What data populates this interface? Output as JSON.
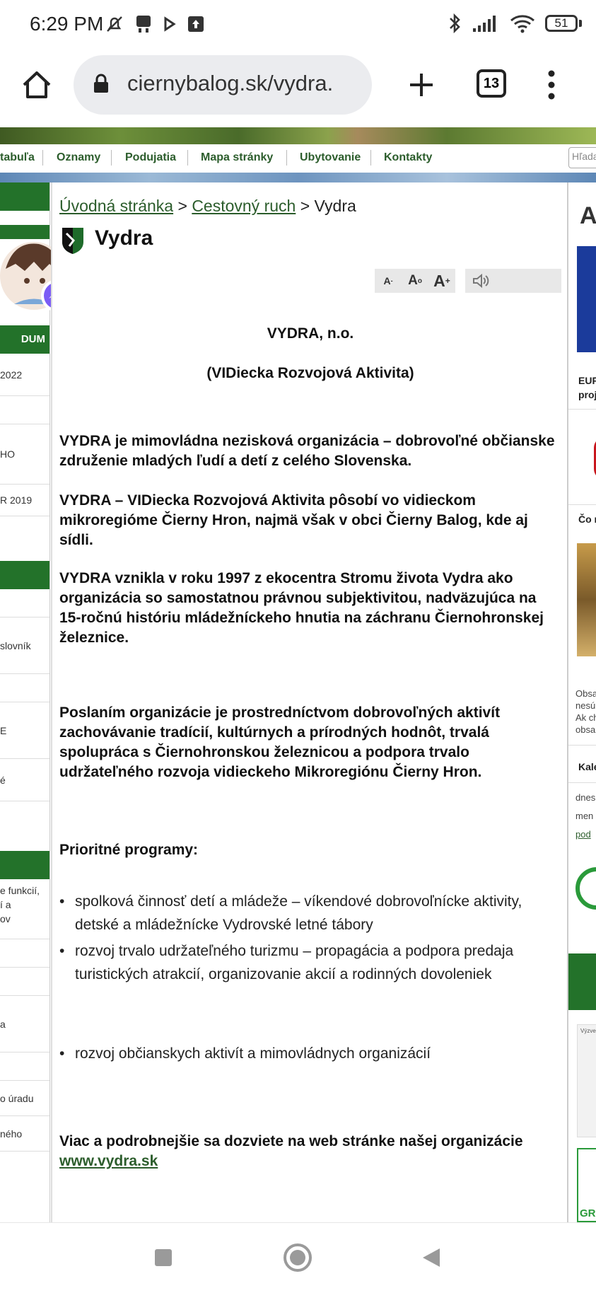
{
  "status_bar": {
    "time": "6:29 PM",
    "battery": "51"
  },
  "browser": {
    "url": "ciernybalog.sk/vydra.",
    "tab_count": "13"
  },
  "nav": {
    "items": [
      "tabuľa",
      "Oznamy",
      "Podujatia",
      "Mapa stránky",
      "Ubytovanie",
      "Kontakty"
    ],
    "search_placeholder": "Hľada"
  },
  "left_column": {
    "heading": "DUM",
    "items": [
      "2022",
      "HO",
      "R 2019",
      "slovník",
      "E",
      "é",
      "e funkcií,",
      "í a",
      "ov",
      "a",
      "o úradu",
      "ného"
    ]
  },
  "right_column": {
    "top_letter": "A",
    "eu_line1": "EUR",
    "eu_line2": "proj",
    "co_label": "Čo r",
    "small1": "Obsa",
    "small2": "nesú",
    "small3": "Ak ch",
    "small4": "obsa",
    "kal": "Kale",
    "dnes": "dnes",
    "men": "men",
    "pod": "pod",
    "gr": "GR",
    "vyzve": "Výzve"
  },
  "breadcrumb": {
    "home": "Úvodná stránka",
    "section": "Cestovný ruch",
    "current": "Vydra",
    "sep": ">"
  },
  "page": {
    "title": "Vydra",
    "font_small": "A",
    "font_normal": "A",
    "font_large": "A",
    "heading1": "VYDRA, n.o.",
    "heading2": "(VIDiecka Rozvojová Aktivita)",
    "p1": "VYDRA je mimovládna nezisková organizácia – dobrovoľné občianske združenie mladých ľudí a detí z celého Slovenska.",
    "p2": "VYDRA – VIDiecka Rozvojová Aktivita pôsobí vo vidieckom mikroregióme Čierny Hron, najmä však v obci Čierny Balog, kde aj sídli.",
    "p3": "VYDRA vznikla v roku 1997 z ekocentra Stromu života Vydra ako organizácia so samostatnou právnou subjektivitou, nadväzujúca na 15-ročnú históriu mládežníckeho hnutia na záchranu Čiernohronskej železnice.",
    "p4": "Poslaním organizácie je prostredníctvom dobrovoľných aktivít zachovávanie tradícií, kultúrnych a prírodných hodnôt, trvalá spolupráca s Čiernohronskou železnicou a podpora trvalo udržateľného rozvoja vidieckeho Mikroregiónu Čierny Hron.",
    "programs_heading": "Prioritné programy:",
    "programs": [
      "spolková činnosť detí a mládeže – víkendové dobrovoľnícke aktivity, detské a mládežnícke Vydrovské letné tábory",
      " rozvoj trvalo udržateľného turizmu – propagácia a podpora predaja turistických atrakcií, organizovanie akcií a rodinných dovoleniek",
      "rozvoj občianskych aktivít a mimovládnych organizácií"
    ],
    "more_text": "Viac a podrobnejšie sa dozviete na web stránke našej organizácie",
    "link": "www.vydra.sk"
  },
  "colors": {
    "green": "#23722a",
    "link": "#2c5d2c"
  }
}
